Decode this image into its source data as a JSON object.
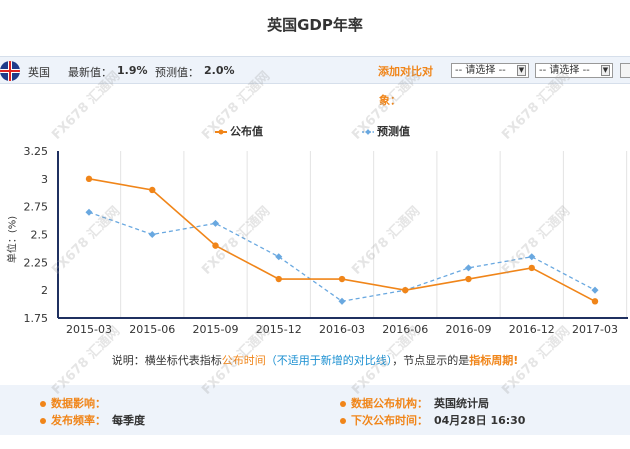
{
  "title": "英国GDP年率",
  "header": {
    "country": "英国",
    "latest_label": "最新值：",
    "latest_value": "1.9%",
    "forecast_label": "预测值：",
    "forecast_value": "2.0%",
    "add_compare": "添加对比对",
    "add_compare_2": "象：",
    "select_1": "-- 请选择 --",
    "select_2": "-- 请选择 --"
  },
  "ylabel": "单位：(%)",
  "legend": {
    "published": "公布值",
    "forecast": "预测值"
  },
  "colors": {
    "published": "#f08519",
    "forecast": "#69a8e0",
    "axis": "#1f3060",
    "grid": "#e3e3e3",
    "accent": "#f08519",
    "link_blue": "#1a8fd1",
    "panel_bg": "#eef3fa"
  },
  "chart_data": {
    "type": "line",
    "categories": [
      "2015-03",
      "2015-06",
      "2015-09",
      "2015-12",
      "2016-03",
      "2016-06",
      "2016-09",
      "2016-12",
      "2017-03"
    ],
    "series": [
      {
        "name": "公布值",
        "values": [
          3.0,
          2.9,
          2.4,
          2.1,
          2.1,
          2.0,
          2.1,
          2.2,
          1.9
        ]
      },
      {
        "name": "预测值",
        "values": [
          2.7,
          2.5,
          2.6,
          2.3,
          1.9,
          2.0,
          2.2,
          2.3,
          2.0
        ]
      }
    ],
    "yticks": [
      "3.25",
      "3",
      "2.75",
      "2.5",
      "2.25",
      "2",
      "1.75"
    ],
    "ylim": [
      1.75,
      3.25
    ],
    "grid": true,
    "legend_position": "top"
  },
  "note": {
    "p1": "说明：横坐标代表指标",
    "p2": "公布时间",
    "p3": "（不适用于新增的对比线）",
    "p4": "，节点显示的是",
    "p5": "指标周期",
    "p6": "!"
  },
  "info": {
    "impact_label": "数据影响：",
    "impact_value": "",
    "frequency_label": "发布频率：",
    "frequency_value": "每季度",
    "agency_label": "数据公布机构：",
    "agency_value": "英国统计局",
    "next_label": "下次公布时间：",
    "next_value": "04月28日 16:30"
  },
  "watermark": "FX678 汇通网"
}
